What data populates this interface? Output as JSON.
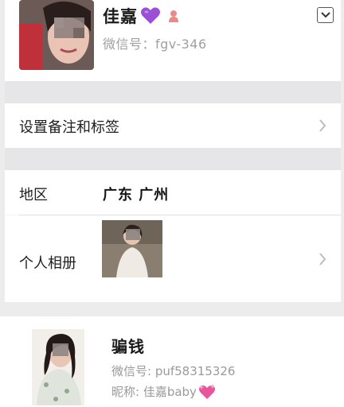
{
  "profile": {
    "name": "佳嘉",
    "wechat_id": "微信号：fgv-346",
    "heart_icon": "purple-heart-icon",
    "gender_icon": "female-icon",
    "dropdown_icon": "chevron-down-icon"
  },
  "rows": {
    "remark_label": "设置备注和标签",
    "region_label": "地区",
    "region_value": "广东 广州",
    "album_label": "个人相册"
  },
  "card": {
    "title": "骗钱",
    "wechat_id": "微信号: puf58315326",
    "nickname": "昵称: 佳嘉baby",
    "nick_icon": "sparkling-heart-icon"
  },
  "colors": {
    "purple": "#9b4fd6",
    "pink": "#e8559a",
    "secondary_text": "#a0a0a0"
  }
}
